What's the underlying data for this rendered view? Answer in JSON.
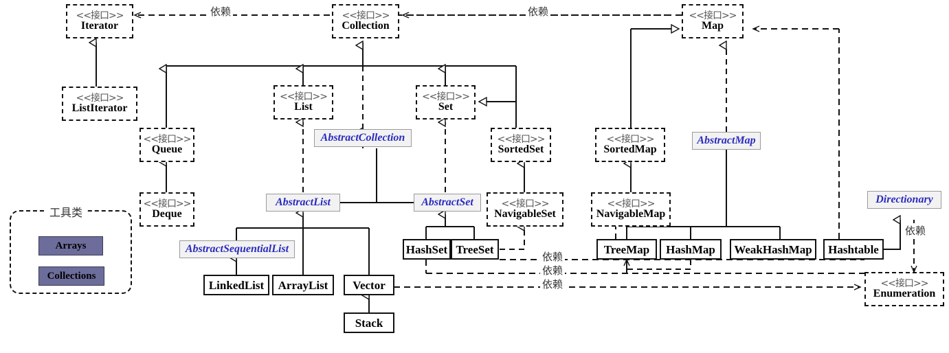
{
  "diagram": {
    "title": "Java Collections Framework UML",
    "stereotype": "<<接口>>",
    "colors": {
      "abstract_text": "#2b2bbf",
      "abstract_fill": "#f2f2f2",
      "utility_fill": "#6d6d9c",
      "line": "#111111"
    },
    "group": {
      "label": "工具类",
      "items": [
        {
          "name": "Arrays"
        },
        {
          "name": "Collections"
        }
      ]
    },
    "interfaces": [
      {
        "name": "Iterator"
      },
      {
        "name": "ListIterator"
      },
      {
        "name": "Collection"
      },
      {
        "name": "List"
      },
      {
        "name": "Set"
      },
      {
        "name": "Queue"
      },
      {
        "name": "Deque"
      },
      {
        "name": "SortedSet"
      },
      {
        "name": "NavigableSet"
      },
      {
        "name": "Map"
      },
      {
        "name": "SortedMap"
      },
      {
        "name": "NavigableMap"
      },
      {
        "name": "Enumeration"
      }
    ],
    "abstract_classes": [
      {
        "name": "AbstractCollection"
      },
      {
        "name": "AbstractList"
      },
      {
        "name": "AbstractSet"
      },
      {
        "name": "AbstractSequentialList"
      },
      {
        "name": "AbstractMap"
      },
      {
        "name": "Directionary"
      }
    ],
    "classes": [
      {
        "name": "LinkedList"
      },
      {
        "name": "ArrayList"
      },
      {
        "name": "Vector"
      },
      {
        "name": "Stack"
      },
      {
        "name": "HashSet"
      },
      {
        "name": "TreeSet"
      },
      {
        "name": "TreeMap"
      },
      {
        "name": "HashMap"
      },
      {
        "name": "WeakHashMap"
      },
      {
        "name": "Hashtable"
      }
    ],
    "edge_labels": [
      {
        "id": "dep_collection_iterator",
        "text": "依赖"
      },
      {
        "id": "dep_map_collection",
        "text": "依赖"
      },
      {
        "id": "dep_treeset_row",
        "text": "依赖"
      },
      {
        "id": "dep_hashset_row",
        "text": "依赖"
      },
      {
        "id": "dep_vector_row",
        "text": "依赖"
      },
      {
        "id": "dep_hashtable_directionary",
        "text": "依赖"
      }
    ]
  }
}
